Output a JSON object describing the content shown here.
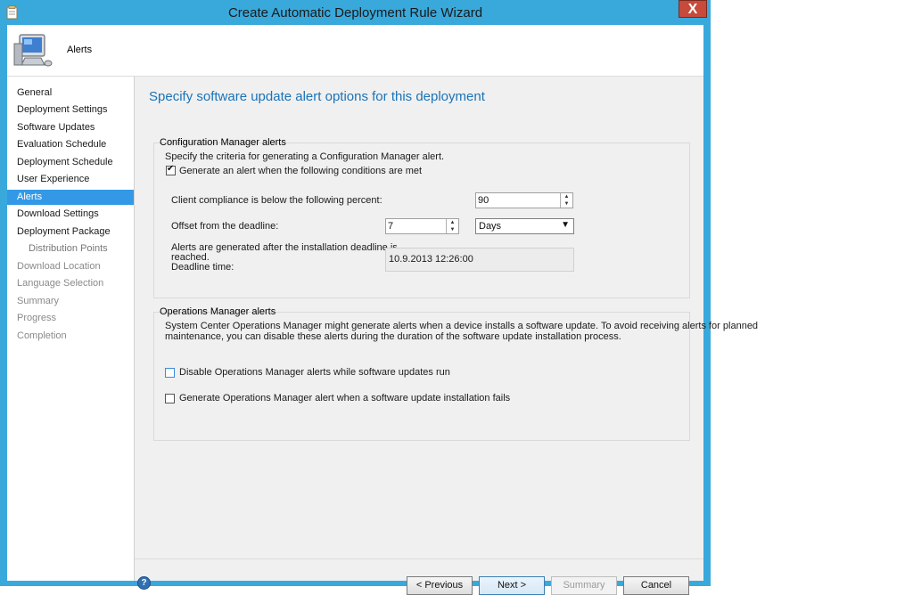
{
  "window": {
    "title": "Create Automatic Deployment Rule Wizard",
    "close_label": "X"
  },
  "header": {
    "title": "Alerts"
  },
  "sidebar": {
    "items": [
      {
        "label": "General",
        "state": "normal"
      },
      {
        "label": "Deployment Settings",
        "state": "normal"
      },
      {
        "label": "Software Updates",
        "state": "normal"
      },
      {
        "label": "Evaluation Schedule",
        "state": "normal"
      },
      {
        "label": "Deployment Schedule",
        "state": "normal"
      },
      {
        "label": "User Experience",
        "state": "normal"
      },
      {
        "label": "Alerts",
        "state": "active"
      },
      {
        "label": "Download Settings",
        "state": "normal"
      },
      {
        "label": "Deployment Package",
        "state": "normal"
      },
      {
        "label": "Distribution Points",
        "state": "disabled-sub"
      },
      {
        "label": "Download Location",
        "state": "disabled"
      },
      {
        "label": "Language Selection",
        "state": "disabled"
      },
      {
        "label": "Summary",
        "state": "disabled"
      },
      {
        "label": "Progress",
        "state": "disabled"
      },
      {
        "label": "Completion",
        "state": "disabled"
      }
    ]
  },
  "main": {
    "page_title": "Specify software update alert options for this deployment",
    "cm_alerts": {
      "group_label": "Configuration Manager alerts",
      "description": "Specify the criteria for generating a Configuration Manager alert.",
      "generate_checkbox_label": "Generate an alert when the following conditions are met",
      "generate_checked": true,
      "compliance_label": "Client compliance is below the  following percent:",
      "compliance_value": "90",
      "offset_label": "Offset from the deadline:",
      "offset_value": "7",
      "offset_unit": "Days",
      "note_line1": "Alerts are generated after the installation deadline is",
      "note_line2": "reached.",
      "deadline_label": "Deadline time:",
      "deadline_value": "10.9.2013 12:26:00"
    },
    "om_alerts": {
      "group_label": "Operations Manager alerts",
      "description_line1": "System Center Operations Manager might generate alerts when a device installs a software update. To avoid receiving alerts for planned",
      "description_line2": "maintenance, you can disable these alerts during the duration of the software update installation process.",
      "disable_label": "Disable Operations Manager alerts while software updates run",
      "disable_checked": false,
      "generate_fail_label": "Generate Operations Manager alert when a software update installation fails",
      "generate_fail_checked": false
    }
  },
  "footer": {
    "help_label": "?",
    "previous_label": "< Previous",
    "next_label": "Next >",
    "summary_label": "Summary",
    "cancel_label": "Cancel"
  },
  "colors": {
    "title_blue": "#1a73b8",
    "active_nav": "#3399e6",
    "window_border": "#39a9dc"
  }
}
